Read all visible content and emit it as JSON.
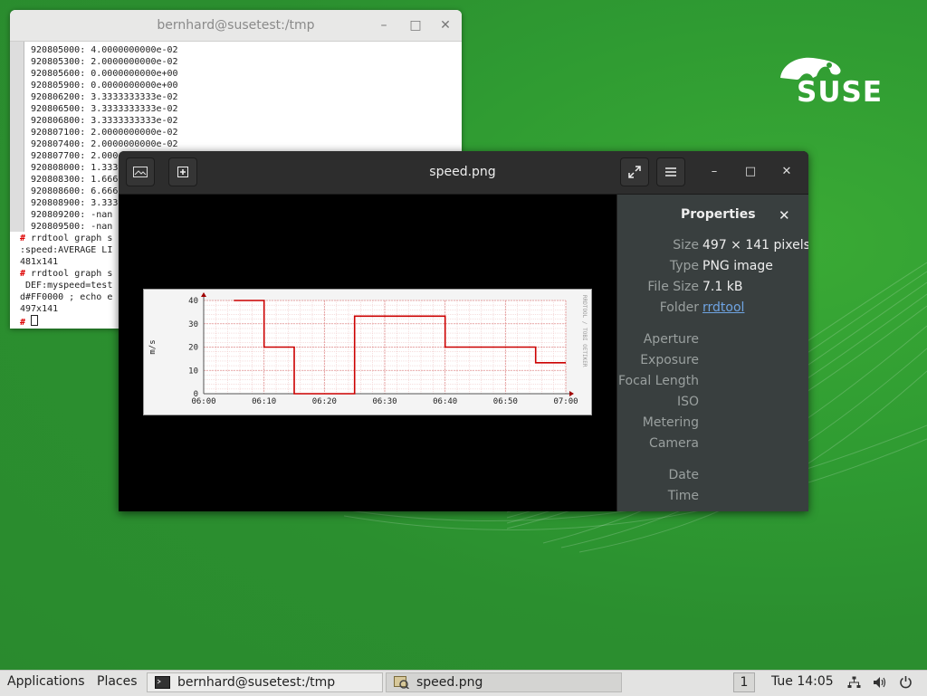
{
  "desktop": {
    "brand_name": "SUSE",
    "accent": "#30ba78"
  },
  "terminal": {
    "title": "bernhard@susetest:/tmp",
    "lines": [
      "920805000: 4.0000000000e-02",
      "920805300: 2.0000000000e-02",
      "920805600: 0.0000000000e+00",
      "920805900: 0.0000000000e+00",
      "920806200: 3.3333333333e-02",
      "920806500: 3.3333333333e-02",
      "920806800: 3.3333333333e-02",
      "920807100: 2.0000000000e-02",
      "920807400: 2.0000000000e-02",
      "920807700: 2.000",
      "920808000: 1.333",
      "920808300: 1.666",
      "920808600: 6.666",
      "920808900: 3.333",
      "920809200: -nan",
      "920809500: -nan"
    ],
    "session_lines": [
      {
        "prompt": "#",
        "text": " rrdtool graph s"
      },
      {
        "prompt": "",
        "text": ":speed:AVERAGE LI"
      },
      {
        "prompt": "",
        "text": "481x141"
      },
      {
        "prompt": "#",
        "text": " rrdtool graph s"
      },
      {
        "prompt": "",
        "text": " DEF:myspeed=test"
      },
      {
        "prompt": "",
        "text": "d#FF0000 ; echo e"
      },
      {
        "prompt": "",
        "text": "497x141"
      },
      {
        "prompt": "#",
        "text": " "
      }
    ]
  },
  "viewer": {
    "title": "speed.png",
    "properties": {
      "heading": "Properties",
      "rows": [
        {
          "key": "Size",
          "value": "497 × 141 pixels",
          "link": false
        },
        {
          "key": "Type",
          "value": "PNG image",
          "link": false
        },
        {
          "key": "File Size",
          "value": "7.1 kB",
          "link": false
        },
        {
          "key": "Folder",
          "value": "rrdtool",
          "link": true
        },
        {
          "key": "Aperture",
          "value": "",
          "link": false
        },
        {
          "key": "Exposure",
          "value": "",
          "link": false
        },
        {
          "key": "Focal Length",
          "value": "",
          "link": false
        },
        {
          "key": "ISO",
          "value": "",
          "link": false
        },
        {
          "key": "Metering",
          "value": "",
          "link": false
        },
        {
          "key": "Camera",
          "value": "",
          "link": false
        },
        {
          "key": "Date",
          "value": "",
          "link": false
        },
        {
          "key": "Time",
          "value": "",
          "link": false
        }
      ]
    }
  },
  "chart_data": {
    "type": "line",
    "step": true,
    "ylabel": "m/s",
    "watermark": "RRDTOOL / TOBI OETIKER",
    "x_ticks": [
      "06:00",
      "06:10",
      "06:20",
      "06:30",
      "06:40",
      "06:50",
      "07:00"
    ],
    "y_ticks": [
      0,
      10,
      20,
      30,
      40
    ],
    "ylim": [
      0,
      40
    ],
    "xlim_minutes": [
      0,
      60
    ],
    "series": [
      {
        "color": "#cc0000",
        "x_minutes": [
          5,
          10,
          10,
          15,
          15,
          25,
          25,
          40,
          40,
          55,
          55,
          60
        ],
        "values": [
          40,
          40,
          20,
          20,
          0,
          0,
          33.3,
          33.3,
          20,
          20,
          13.3,
          13.3
        ]
      }
    ]
  },
  "taskbar": {
    "applications": "Applications",
    "places": "Places",
    "tasks": [
      {
        "label": "bernhard@susetest:/tmp",
        "active": false
      },
      {
        "label": "speed.png",
        "active": true
      }
    ],
    "workspace": "1",
    "clock": "Tue 14:05"
  }
}
